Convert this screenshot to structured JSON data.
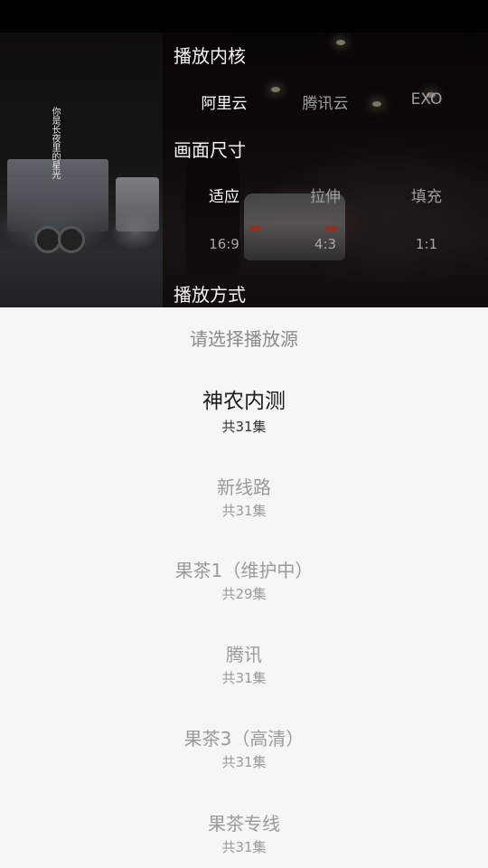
{
  "video_overlay": {
    "caption_text": "你是长夜里的星光",
    "sections": {
      "kernel_title": "播放内核",
      "kernel_options": [
        "阿里云",
        "腾讯云",
        "EXO"
      ],
      "kernel_selected": "阿里云",
      "size_title": "画面尺寸",
      "size_options": [
        "适应",
        "拉伸",
        "填充"
      ],
      "size_selected": "适应",
      "ratio_options": [
        "16:9",
        "4:3",
        "1:1"
      ],
      "mode_title": "播放方式"
    }
  },
  "source_picker": {
    "title": "请选择播放源",
    "selected_index": 0,
    "items": [
      {
        "name": "神农内测",
        "count": "共31集"
      },
      {
        "name": "新线路",
        "count": "共31集"
      },
      {
        "name": "果茶1（维护中）",
        "count": "共29集"
      },
      {
        "name": "腾讯",
        "count": "共31集"
      },
      {
        "name": "果茶3（高清）",
        "count": "共31集"
      },
      {
        "name": "果茶专线",
        "count": "共31集"
      }
    ]
  },
  "colors": {
    "sheet_background": "#f6f6f6",
    "selected_text": "#1c1c1c",
    "muted_text": "#9a9a9a",
    "overlay_active": "#ffffff",
    "overlay_inactive": "#9e9e9e"
  }
}
